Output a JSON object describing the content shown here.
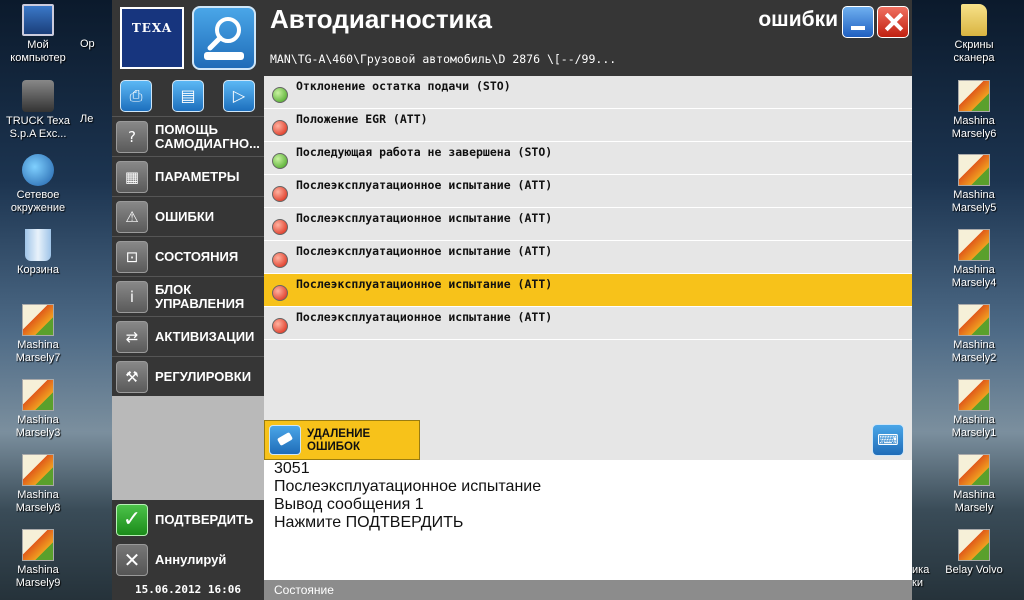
{
  "desktop": {
    "left_icons": [
      {
        "label": "Мой компьютер",
        "icon": "computer-icon"
      },
      {
        "label": "TRUCK Texa S.p.A Exc...",
        "icon": "truck-texa-icon"
      },
      {
        "label": "Сетевое окружение",
        "icon": "network-icon"
      },
      {
        "label": "Корзина",
        "icon": "recycle-bin-icon"
      },
      {
        "label": "Mashina Marsely7",
        "icon": "picture-file-icon"
      },
      {
        "label": "Mashina Marsely3",
        "icon": "picture-file-icon"
      },
      {
        "label": "Mashina Marsely8",
        "icon": "picture-file-icon"
      },
      {
        "label": "Mashina Marsely9",
        "icon": "picture-file-icon"
      }
    ],
    "right_icons": [
      {
        "label": "Скрины сканера",
        "icon": "folder-icon"
      },
      {
        "label": "Mashina Marsely6",
        "icon": "picture-file-icon"
      },
      {
        "label": "Mashina Marsely5",
        "icon": "picture-file-icon"
      },
      {
        "label": "Mashina Marsely4",
        "icon": "picture-file-icon"
      },
      {
        "label": "Mashina Marsely2",
        "icon": "picture-file-icon"
      },
      {
        "label": "Mashina Marsely1",
        "icon": "picture-file-icon"
      },
      {
        "label": "Mashina Marsely",
        "icon": "picture-file-icon"
      },
      {
        "label": "Belay Volvo",
        "icon": "picture-file-icon"
      }
    ],
    "partial_labels": {
      "top": "Ор",
      "second": "Ле",
      "bottom_right": "ика\nки"
    }
  },
  "app": {
    "logo_text": "TEXA",
    "title": "Автодиагностика",
    "section": "ошибки",
    "vehicle_path": "MAN\\TG-A\\460\\Грузовой автомобиль\\D 2876 \\[--/99...",
    "datetime": "15.06.2012  16:06",
    "status_label": "Состояние"
  },
  "toolbar": {
    "print_icon": "printer-icon",
    "clapper_icon": "clapperboard-icon",
    "play_icon": "play-icon"
  },
  "sidebar": {
    "items": [
      {
        "label": "ПОМОЩЬ САМОДИАГНО...",
        "icon": "help-icon"
      },
      {
        "label": "ПАРАМЕТРЫ",
        "icon": "grid-icon"
      },
      {
        "label": "ОШИБКИ",
        "icon": "warning-icon"
      },
      {
        "label": "СОСТОЯНИЯ",
        "icon": "state-icon"
      },
      {
        "label": "БЛОК УПРАВЛЕНИЯ",
        "icon": "info-icon"
      },
      {
        "label": "АКТИВИЗАЦИИ",
        "icon": "activation-icon"
      },
      {
        "label": "РЕГУЛИРОВКИ",
        "icon": "tools-icon"
      }
    ],
    "confirm_label": "ПОДТВЕРДИТЬ",
    "cancel_label": "Аннулируй"
  },
  "errors": [
    {
      "text": "Отклонение остатка подачи (STO)",
      "status": "green"
    },
    {
      "text": "Положение EGR  (ATT)",
      "status": "red"
    },
    {
      "text": "Последующая работа не завершена (STO)",
      "status": "green"
    },
    {
      "text": "Послеэксплуатационное испытание  (ATT)",
      "status": "red"
    },
    {
      "text": "Послеэксплуатационное испытание  (ATT)",
      "status": "red"
    },
    {
      "text": "Послеэксплуатационное испытание  (ATT)",
      "status": "red"
    },
    {
      "text": "Послеэксплуатационное испытание (ATT)",
      "status": "red",
      "selected": true
    },
    {
      "text": "Послеэксплуатационное испытание (ATT)",
      "status": "red"
    }
  ],
  "actions": {
    "delete_label": "УДАЛЕНИЕ ОШИБОК",
    "keyboard_icon": "keyboard-icon"
  },
  "message": {
    "code": "3051",
    "line1": "Послеэксплуатационное испытание",
    "line2": "Вывод сообщения 1",
    "line3": "Нажмите ПОДТВЕРДИТЬ"
  },
  "colors": {
    "selected_row": "#f7c21a",
    "ok_status": "#3fa01c",
    "error_status": "#d8200c",
    "panel_dark": "#363636"
  }
}
